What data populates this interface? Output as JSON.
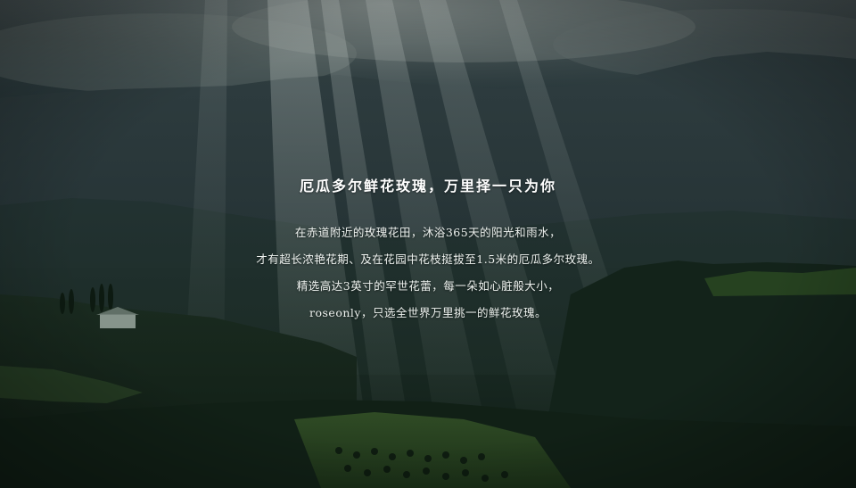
{
  "headline": "厄瓜多尔鲜花玫瑰，万里择一只为你",
  "body_lines": [
    "在赤道附近的玫瑰花田，沐浴365天的阳光和雨水，",
    "才有超长浓艳花期、及在花园中花枝挺拔至1.5米的厄瓜多尔玫瑰。",
    "精选高达3英寸的罕世花蕾，每一朵如心脏般大小，",
    "roseonly，只选全世界万里挑一的鲜花玫瑰。"
  ],
  "colors": {
    "sky": "#4e5a5c",
    "mountain": "#2a3a3c",
    "hills": "#1c3024",
    "field": "#2f4a22",
    "text": "#ffffff"
  }
}
